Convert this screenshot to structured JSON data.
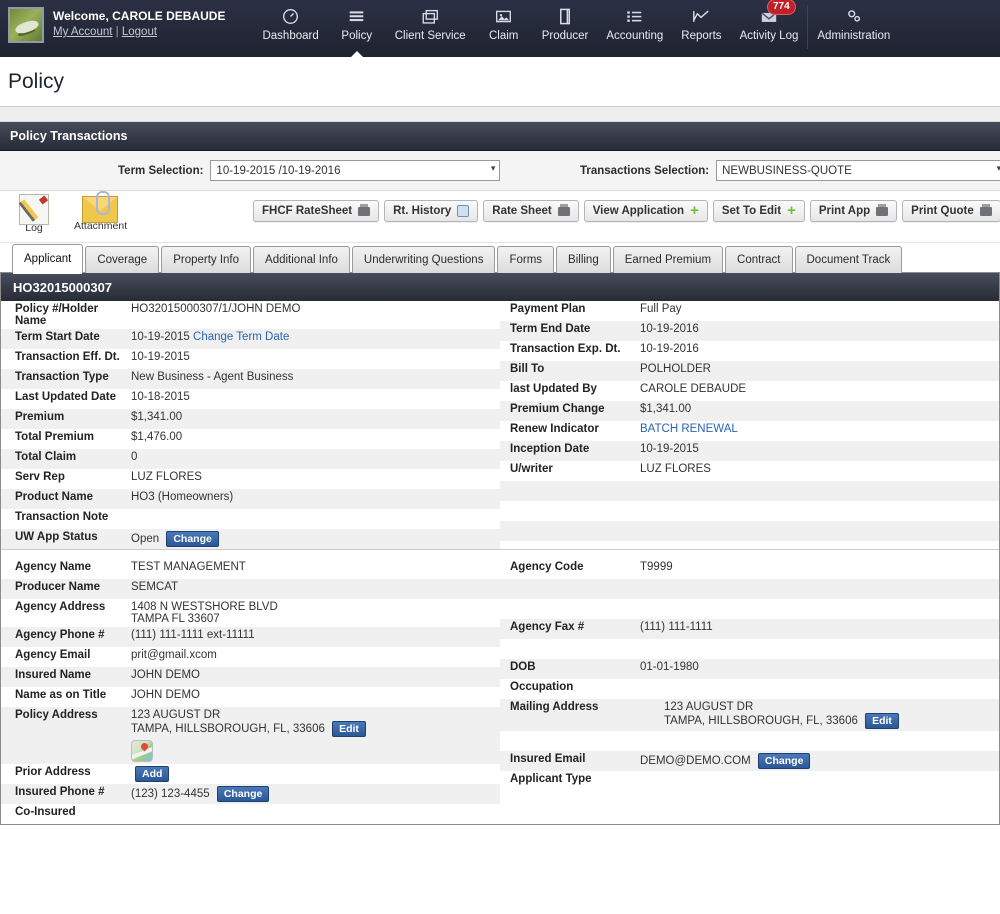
{
  "topbar": {
    "welcome": "Welcome, CAROLE DEBAUDE",
    "my_account": "My Account",
    "separator": "|",
    "logout": "Logout",
    "nav": [
      {
        "label": "Dashboard",
        "icon": "gauge-icon",
        "active": false
      },
      {
        "label": "Policy",
        "icon": "list-lines-icon",
        "active": true
      },
      {
        "label": "Client Service",
        "icon": "windows-icon",
        "active": false
      },
      {
        "label": "Claim",
        "icon": "picture-icon",
        "active": false
      },
      {
        "label": "Producer",
        "icon": "document-icon",
        "active": false
      },
      {
        "label": "Accounting",
        "icon": "bullet-list-icon",
        "active": false
      },
      {
        "label": "Reports",
        "icon": "chart-line-icon",
        "active": false
      },
      {
        "label": "Activity Log",
        "icon": "envelope-icon",
        "badge": "774",
        "active": false
      },
      {
        "label": "Administration",
        "icon": "gears-icon",
        "active": false
      }
    ]
  },
  "page": {
    "title": "Policy"
  },
  "panel": {
    "title": "Policy Transactions"
  },
  "selection": {
    "term_label": "Term Selection:",
    "term_value": "10-19-2015 /10-19-2016",
    "transactions_label": "Transactions Selection:",
    "transactions_value": "NEWBUSINESS-QUOTE"
  },
  "toolbar": {
    "icons": [
      {
        "name": "log-icon",
        "caption": "Log"
      },
      {
        "name": "attachment-icon",
        "caption": "Attachment"
      }
    ],
    "buttons": [
      {
        "label": "FHCF RateSheet",
        "glyph": "print"
      },
      {
        "label": "Rt. History",
        "glyph": "search"
      },
      {
        "label": "Rate Sheet",
        "glyph": "print"
      },
      {
        "label": "View Application",
        "glyph": "plus"
      },
      {
        "label": "Set To Edit",
        "glyph": "plus"
      },
      {
        "label": "Print App",
        "glyph": "print"
      },
      {
        "label": "Print Quote",
        "glyph": "print"
      }
    ]
  },
  "tabs": [
    {
      "label": "Applicant",
      "active": true
    },
    {
      "label": "Coverage",
      "active": false
    },
    {
      "label": "Property Info",
      "active": false
    },
    {
      "label": "Additional Info",
      "active": false
    },
    {
      "label": "Underwriting Questions",
      "active": false
    },
    {
      "label": "Forms",
      "active": false
    },
    {
      "label": "Billing",
      "active": false
    },
    {
      "label": "Earned Premium",
      "active": false
    },
    {
      "label": "Contract",
      "active": false
    },
    {
      "label": "Document Track",
      "active": false
    }
  ],
  "card": {
    "header": "HO32015000307",
    "policy_left": [
      {
        "label": "Policy #/Holder Name",
        "value": "HO32015000307/1/JOHN DEMO"
      },
      {
        "label": "Term Start Date",
        "value": "10-19-2015",
        "link": "Change Term Date"
      },
      {
        "label": "Transaction Eff. Dt.",
        "value": "10-19-2015"
      },
      {
        "label": "Transaction Type",
        "value": "New Business - Agent Business"
      },
      {
        "label": "Last Updated Date",
        "value": "10-18-2015"
      },
      {
        "label": "Premium",
        "value": "$1,341.00"
      },
      {
        "label": "Total Premium",
        "value": "$1,476.00"
      },
      {
        "label": "Total Claim",
        "value": "0"
      },
      {
        "label": "Serv Rep",
        "value": "LUZ FLORES"
      },
      {
        "label": "Product Name",
        "value": "HO3 (Homeowners)"
      },
      {
        "label": "Transaction Note",
        "value": ""
      },
      {
        "label": "UW App Status",
        "value": "Open",
        "button": "Change"
      }
    ],
    "policy_right": [
      {
        "label": "Payment Plan",
        "value": "Full Pay"
      },
      {
        "label": "Term End Date",
        "value": "10-19-2016"
      },
      {
        "label": "Transaction Exp. Dt.",
        "value": "10-19-2016"
      },
      {
        "label": "Bill To",
        "value": "POLHOLDER"
      },
      {
        "label": "last Updated By",
        "value": "CAROLE DEBAUDE"
      },
      {
        "label": "Premium Change",
        "value": "$1,341.00"
      },
      {
        "label": "Renew Indicator",
        "value": "",
        "link": "BATCH RENEWAL"
      },
      {
        "label": "Inception Date",
        "value": "10-19-2015"
      },
      {
        "label": "U/writer",
        "value": "LUZ FLORES"
      },
      {
        "label": "",
        "value": ""
      },
      {
        "label": "",
        "value": ""
      },
      {
        "label": "",
        "value": ""
      }
    ],
    "agency_left": [
      {
        "label": "Agency Name",
        "value": "TEST MANAGEMENT"
      },
      {
        "label": "Producer Name",
        "value": "SEMCAT"
      },
      {
        "label": "Agency Address",
        "value": "1408 N WESTSHORE BLVD",
        "value2": "TAMPA FL 33607"
      },
      {
        "label": "Agency Phone #",
        "value": "(111) 111-1111 ext-11111"
      },
      {
        "label": "Agency Email",
        "value": "prit@gmail.xcom"
      },
      {
        "label": "Insured Name",
        "value": "JOHN DEMO"
      },
      {
        "label": "Name as on Title",
        "value": "JOHN DEMO"
      },
      {
        "label": "Policy Address",
        "value": "123 AUGUST DR",
        "value2": "TAMPA, HILLSBOROUGH, FL, 33606",
        "button": "Edit",
        "map": true
      },
      {
        "label": "Prior Address",
        "value": "",
        "button": "Add"
      },
      {
        "label": "Insured Phone #",
        "value": "(123) 123-4455",
        "button": "Change"
      },
      {
        "label": "Co-Insured",
        "value": ""
      }
    ],
    "agency_right": [
      {
        "label": "Agency Code",
        "value": "T9999"
      },
      {
        "label": "",
        "value": ""
      },
      {
        "label": "",
        "value": ""
      },
      {
        "label": "Agency Fax #",
        "value": "(111) 111-1111"
      },
      {
        "label": "",
        "value": ""
      },
      {
        "label": "DOB",
        "value": "01-01-1980"
      },
      {
        "label": "Occupation",
        "value": ""
      },
      {
        "label": "Mailing Address",
        "value": "123 AUGUST DR",
        "value2": "TAMPA, HILLSBOROUGH, FL, 33606",
        "button": "Edit",
        "indent": true
      },
      {
        "label": "",
        "value": ""
      },
      {
        "label": "Insured Email",
        "value": "DEMO@DEMO.COM",
        "button": "Change"
      },
      {
        "label": "Applicant Type",
        "value": ""
      }
    ]
  },
  "colors": {
    "nav_bg": "#252a3a",
    "panel_header": "#343a46",
    "badge_red": "#c0202a",
    "link_blue": "#2a63b5",
    "button_blue": "#2b5896"
  }
}
